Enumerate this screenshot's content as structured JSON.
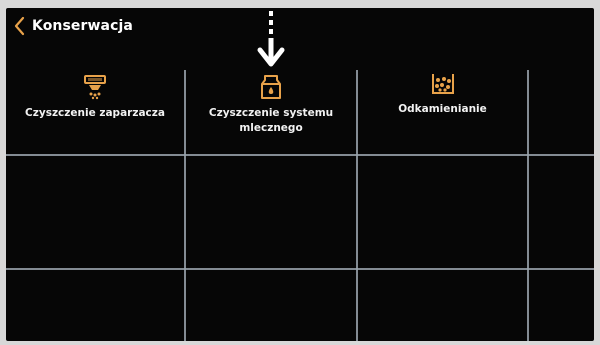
{
  "header": {
    "title": "Konserwacja",
    "back_icon": "chevron-left-icon"
  },
  "tiles": [
    {
      "label": "Czyszczenie zaparzacza",
      "icon": "brewer-cleaning-icon"
    },
    {
      "label": "Czyszczenie systemu mlecznego",
      "icon": "milk-carton-icon"
    },
    {
      "label": "Odkamienianie",
      "icon": "descaling-container-icon"
    }
  ],
  "colors": {
    "accent": "#e8a24a",
    "background": "#060606",
    "grid": "#9aa3ad",
    "text": "#ffffff"
  }
}
